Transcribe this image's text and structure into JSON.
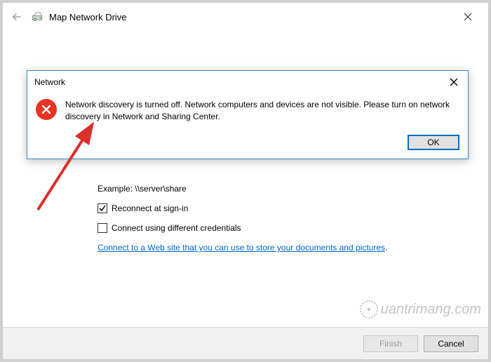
{
  "window": {
    "title": "Map Network Drive"
  },
  "form": {
    "example_label": "Example: \\\\server\\share",
    "reconnect_label": "Reconnect at sign-in",
    "reconnect_checked": true,
    "different_creds_label": "Connect using different credentials",
    "different_creds_checked": false,
    "link_text": "Connect to a Web site that you can use to store your documents and pictures"
  },
  "buttons": {
    "finish": "Finish",
    "cancel": "Cancel"
  },
  "dialog": {
    "title": "Network",
    "message": "Network discovery is turned off. Network computers and devices are not visible. Please turn on network discovery in Network and Sharing Center.",
    "ok": "OK"
  },
  "watermark": "uantrimang.com"
}
